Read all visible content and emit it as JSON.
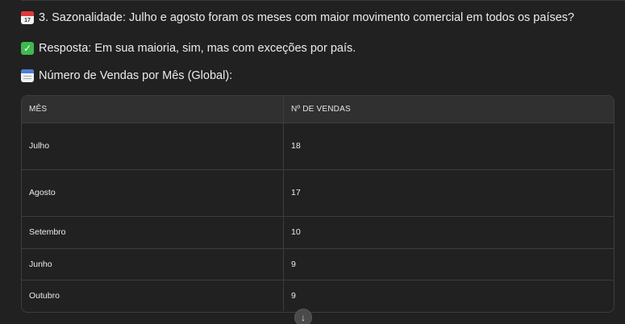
{
  "lines": {
    "seasonality": "3. Sazonalidade: Julho e agosto foram os meses com maior movimento comercial em todos os países?",
    "answer": "Resposta: Em sua maioria, sim, mas com exceções por país.",
    "table_heading": "Número de Vendas por Mês (Global):"
  },
  "icons": {
    "calendar": "calendar-icon",
    "calendar_day": "17",
    "check": "check-mark-icon",
    "spiral_calendar": "spiral-calendar-icon",
    "scroll_down": "arrow-down-icon"
  },
  "table": {
    "headers": [
      "MÊS",
      "Nº DE VENDAS"
    ],
    "rows": [
      {
        "month": "Julho",
        "sales": "18"
      },
      {
        "month": "Agosto",
        "sales": "17"
      },
      {
        "month": "Setembro",
        "sales": "10"
      },
      {
        "month": "Junho",
        "sales": "9"
      },
      {
        "month": "Outubro",
        "sales": "9"
      }
    ]
  },
  "colors": {
    "background": "#212121",
    "header_row": "#303030",
    "border": "#3d3d3d",
    "text": "#ececec",
    "check_green": "#3fb950"
  }
}
